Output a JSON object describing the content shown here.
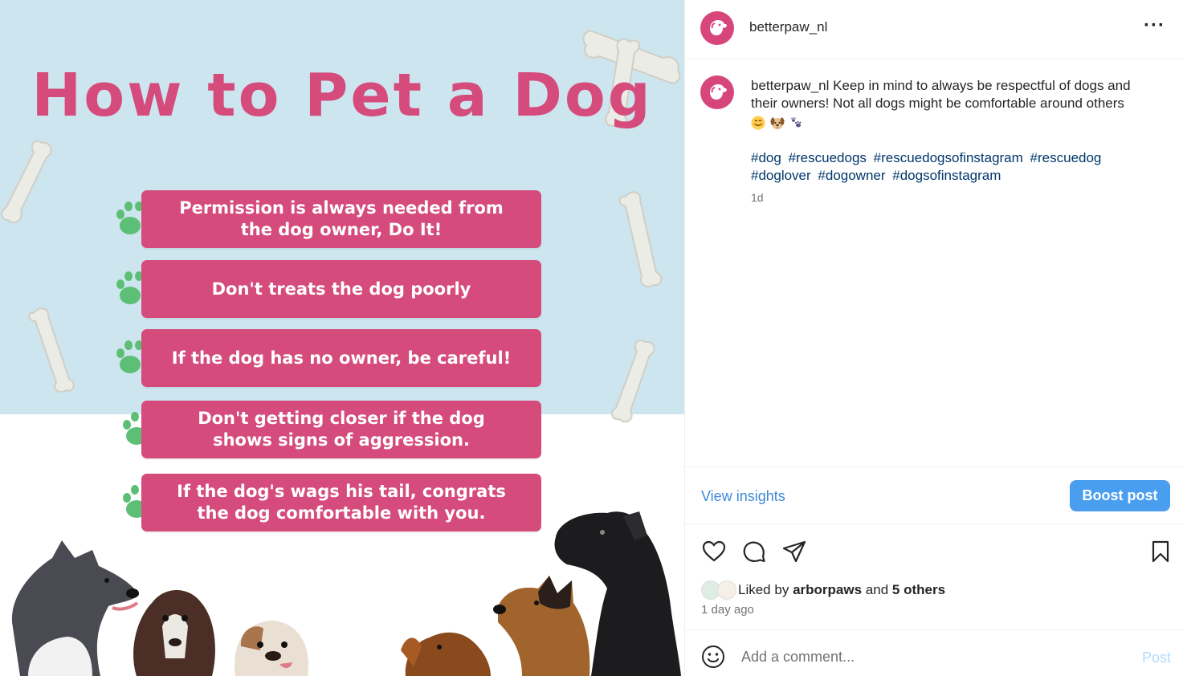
{
  "image": {
    "headline": "How to Pet a Dog",
    "tips": [
      "Permission is always needed from the dog owner, Do It!",
      "Don't treats the dog poorly",
      "If the dog has no owner, be careful!",
      "Don't getting closer if the dog shows signs of aggression.",
      "If the dog's wags his tail, congrats the dog comfortable with you."
    ]
  },
  "header": {
    "username": "betterpaw_nl",
    "more_label": "···"
  },
  "caption": {
    "username": "betterpaw_nl",
    "text": "Keep in mind to always be respectful of dogs and their owners! Not all dogs might be comfortable around others",
    "emojis": [
      "smiling-face-emoji",
      "dog-face-emoji",
      "paw-prints-emoji"
    ],
    "hashtags": [
      "#dog",
      "#rescuedogs",
      "#rescuedogsofinstagram",
      "#rescuedog",
      "#doglover",
      "#dogowner",
      "#dogsofinstagram"
    ],
    "time": "1d"
  },
  "insights": {
    "view_label": "View insights",
    "boost_label": "Boost post"
  },
  "actions": {
    "icons": [
      "heart-icon",
      "comment-icon",
      "share-icon",
      "bookmark-icon"
    ],
    "liked_prefix": "Liked by",
    "liked_user": "arborpaws",
    "liked_and": "and",
    "liked_others": "5 others",
    "time_ago": "1 day ago"
  },
  "comment": {
    "placeholder": "Add a comment...",
    "post_label": "Post"
  },
  "colors": {
    "brand_pink": "#d44b7c",
    "sky_blue": "#cde5ef",
    "paw_green": "#5cbf75",
    "link_blue": "#3f8ad6",
    "boost_blue": "#4a9ef0",
    "hashtag_blue": "#00376b"
  }
}
